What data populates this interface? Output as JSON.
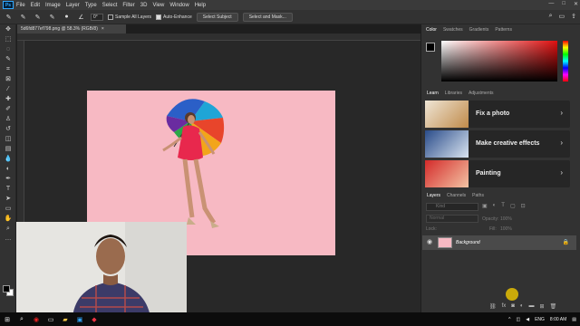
{
  "menu": {
    "logo": "Ps",
    "items": [
      "File",
      "Edit",
      "Image",
      "Layer",
      "Type",
      "Select",
      "Filter",
      "3D",
      "View",
      "Window",
      "Help"
    ],
    "window_controls": [
      "—",
      "□",
      "✕"
    ]
  },
  "options_bar": {
    "angle_value": "0°",
    "sample_all_layers": "Sample All Layers",
    "auto_enhance": "Auto-Enhance",
    "select_subject": "Select Subject",
    "select_and_mask": "Select and Mask..."
  },
  "document": {
    "tab_title": "5d6fd877ef798.png @ 58.3% (RGB/8)",
    "close": "×"
  },
  "color_panel": {
    "tabs": [
      "Color",
      "Swatches",
      "Gradients",
      "Patterns"
    ],
    "accent": "#e01010"
  },
  "learn_panel": {
    "tabs": [
      "Learn",
      "Libraries",
      "Adjustments"
    ],
    "cards": [
      {
        "label": "Fix a photo"
      },
      {
        "label": "Make creative effects"
      },
      {
        "label": "Painting"
      }
    ]
  },
  "layers_panel": {
    "tabs": [
      "Layers",
      "Channels",
      "Paths"
    ],
    "search_placeholder": "Kind",
    "blend_mode": "Normal",
    "opacity_label": "Opacity:",
    "opacity_value": "100%",
    "lock_label": "Lock:",
    "fill_label": "Fill:",
    "fill_value": "100%",
    "layer_name": "Background"
  },
  "taskbar": {
    "language": "ENG",
    "time": "8:00 AM"
  }
}
